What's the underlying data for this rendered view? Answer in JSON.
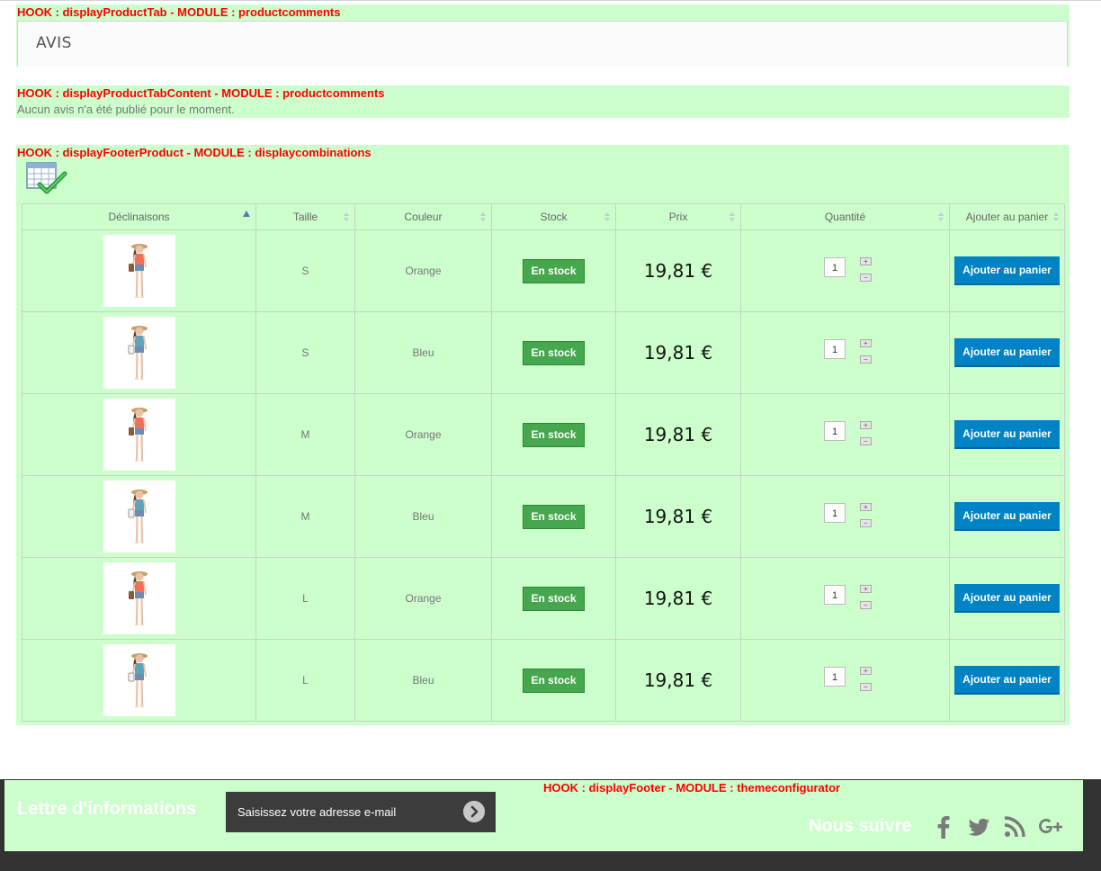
{
  "hooks": {
    "product_tab": "HOOK : displayProductTab - MODULE : productcomments",
    "product_tab_content": "HOOK : displayProductTabContent - MODULE : productcomments",
    "footer_product": "HOOK : displayFooterProduct - MODULE : displaycombinations",
    "footer": "HOOK : displayFooter - MODULE : themeconfigurator"
  },
  "reviews": {
    "tab_title": "AVIS",
    "empty_message": "Aucun avis n'a été publié pour le moment."
  },
  "combinations": {
    "headers": [
      "Déclinaisons",
      "Taille",
      "Couleur",
      "Stock",
      "Prix",
      "Quantité",
      "Ajouter au panier"
    ],
    "rows": [
      {
        "image": "girl-orange-top",
        "size": "S",
        "color": "Orange",
        "stock": "En stock",
        "price": "19,81 €",
        "qty": "1",
        "button": "Ajouter au panier"
      },
      {
        "image": "girl-blue-top",
        "size": "S",
        "color": "Bleu",
        "stock": "En stock",
        "price": "19,81 €",
        "qty": "1",
        "button": "Ajouter au panier"
      },
      {
        "image": "girl-orange-top",
        "size": "M",
        "color": "Orange",
        "stock": "En stock",
        "price": "19,81 €",
        "qty": "1",
        "button": "Ajouter au panier"
      },
      {
        "image": "girl-blue-top",
        "size": "M",
        "color": "Bleu",
        "stock": "En stock",
        "price": "19,81 €",
        "qty": "1",
        "button": "Ajouter au panier"
      },
      {
        "image": "girl-orange-top",
        "size": "L",
        "color": "Orange",
        "stock": "En stock",
        "price": "19,81 €",
        "qty": "1",
        "button": "Ajouter au panier"
      },
      {
        "image": "girl-blue-top",
        "size": "L",
        "color": "Bleu",
        "stock": "En stock",
        "price": "19,81 €",
        "qty": "1",
        "button": "Ajouter au panier"
      }
    ],
    "qty_plus": "+",
    "qty_minus": "−"
  },
  "footer": {
    "newsletter_title": "Lettre d'informations",
    "newsletter_placeholder": "Saisissez votre adresse e-mail",
    "follow_title": "Nous suivre",
    "social_icons": [
      "facebook-icon",
      "twitter-icon",
      "rss-icon",
      "google-plus-icon"
    ]
  },
  "colors": {
    "hook_background": "#ccffcc",
    "hook_label": "#ff0000",
    "in_stock": "#46a74e",
    "cart_button": "#0083c4",
    "footer_dark": "#333333"
  }
}
